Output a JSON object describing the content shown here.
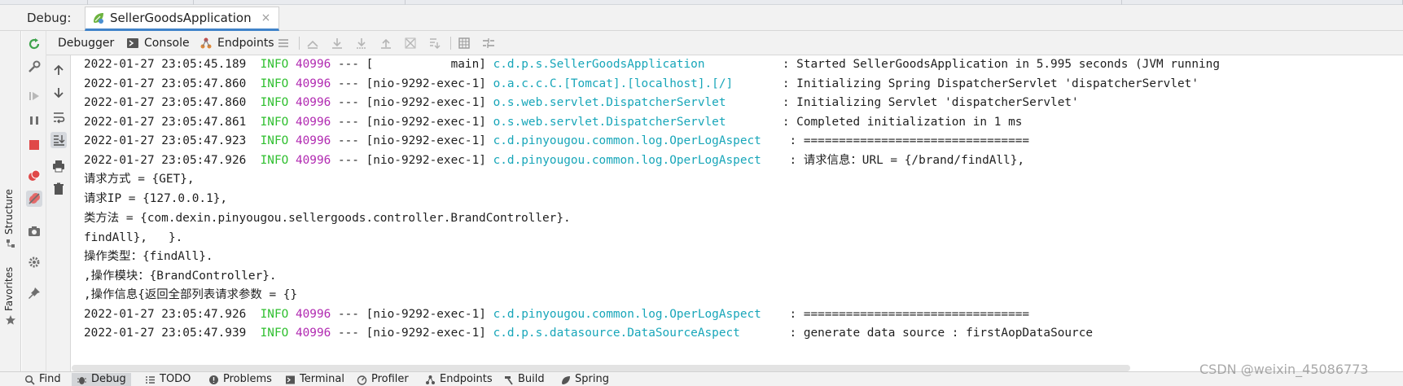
{
  "debug_bar": {
    "label": "Debug:",
    "run_config": "SellerGoodsApplication",
    "close_glyph": "×"
  },
  "toolbar_tabs": {
    "debugger": "Debugger",
    "console": "Console",
    "endpoints": "Endpoints"
  },
  "side_stripe": {
    "structure": "Structure",
    "favorites": "Favorites"
  },
  "colors": {
    "info_level": "#2fbf2f",
    "pid": "#b12ab1",
    "logger_class": "#18a6b9"
  },
  "console": {
    "lines": [
      {
        "ts": "2022-01-27 23:05:45.189",
        "level": "INFO",
        "pid": "40996",
        "sep": "---",
        "thread": "[           main]",
        "logger": "c.d.p.s.SellerGoodsApplication          ",
        "msg": ": Started SellerGoodsApplication in 5.995 seconds (JVM running"
      },
      {
        "ts": "2022-01-27 23:05:47.860",
        "level": "INFO",
        "pid": "40996",
        "sep": "---",
        "thread": "[nio-9292-exec-1]",
        "logger": "o.a.c.c.C.[Tomcat].[localhost].[/]      ",
        "msg": ": Initializing Spring DispatcherServlet 'dispatcherServlet'"
      },
      {
        "ts": "2022-01-27 23:05:47.860",
        "level": "INFO",
        "pid": "40996",
        "sep": "---",
        "thread": "[nio-9292-exec-1]",
        "logger": "o.s.web.servlet.DispatcherServlet       ",
        "msg": ": Initializing Servlet 'dispatcherServlet'"
      },
      {
        "ts": "2022-01-27 23:05:47.861",
        "level": "INFO",
        "pid": "40996",
        "sep": "---",
        "thread": "[nio-9292-exec-1]",
        "logger": "o.s.web.servlet.DispatcherServlet       ",
        "msg": ": Completed initialization in 1 ms"
      },
      {
        "ts": "2022-01-27 23:05:47.923",
        "level": "INFO",
        "pid": "40996",
        "sep": "---",
        "thread": "[nio-9292-exec-1]",
        "logger": "c.d.pinyougou.common.log.OperLogAspect   ",
        "msg": ": ================================"
      },
      {
        "ts": "2022-01-27 23:05:47.926",
        "level": "INFO",
        "pid": "40996",
        "sep": "---",
        "thread": "[nio-9292-exec-1]",
        "logger": "c.d.pinyougou.common.log.OperLogAspect   ",
        "msg": ": 请求信息：URL = {/brand/findAll},"
      },
      {
        "text": "请求方式 = {GET},"
      },
      {
        "text": "请求IP = {127.0.0.1},"
      },
      {
        "text": "类方法 = {com.dexin.pinyougou.sellergoods.controller.BrandController}."
      },
      {
        "text": "findAll},   }."
      },
      {
        "text": "操作类型：{findAll}."
      },
      {
        "text": ",操作模块：{BrandController}."
      },
      {
        "text": ",操作信息{返回全部列表请求参数 = {}"
      },
      {
        "ts": "2022-01-27 23:05:47.926",
        "level": "INFO",
        "pid": "40996",
        "sep": "---",
        "thread": "[nio-9292-exec-1]",
        "logger": "c.d.pinyougou.common.log.OperLogAspect   ",
        "msg": ": ================================"
      },
      {
        "ts": "2022-01-27 23:05:47.939",
        "level": "INFO",
        "pid": "40996",
        "sep": "---",
        "thread": "[nio-9292-exec-1]",
        "logger": "c.d.p.s.datasource.DataSourceAspect      ",
        "msg": ": generate data source : firstAopDataSource"
      }
    ]
  },
  "bottom_tabs": [
    {
      "label": "Find",
      "icon": "search-icon"
    },
    {
      "label": "Debug",
      "icon": "bug-icon",
      "active": true
    },
    {
      "label": "TODO",
      "icon": "list-icon"
    },
    {
      "label": "Problems",
      "icon": "warning-icon"
    },
    {
      "label": "Terminal",
      "icon": "terminal-icon"
    },
    {
      "label": "Profiler",
      "icon": "profiler-icon"
    },
    {
      "label": "Endpoints",
      "icon": "endpoints-icon"
    },
    {
      "label": "Build",
      "icon": "hammer-icon"
    },
    {
      "label": "Spring",
      "icon": "spring-leaf-icon"
    }
  ],
  "watermark": "CSDN @weixin_45086773"
}
